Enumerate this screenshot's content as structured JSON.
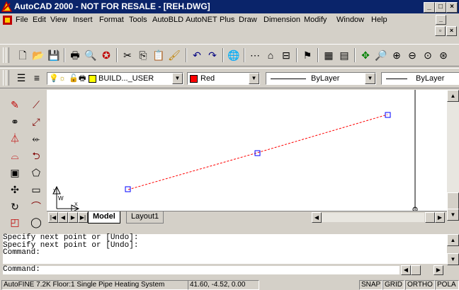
{
  "titlebar": {
    "title": "AutoCAD 2000 - NOT FOR RESALE - [REH.DWG]",
    "min": "_",
    "max": "□",
    "close": "×"
  },
  "menu": {
    "items": [
      "File",
      "Edit",
      "View",
      "Insert",
      "Format",
      "Tools",
      "AutoBLD",
      "AutoNET",
      "Plus",
      "Draw",
      "Dimension",
      "Modify",
      "Window",
      "Help"
    ]
  },
  "layers": {
    "layer_name": "BUILD..._USER",
    "color": "Red",
    "linetype": "ByLayer",
    "lineweight": "ByLayer"
  },
  "tabs": {
    "model": "Model",
    "layout": "Layout1"
  },
  "command": {
    "history": [
      "Specify next point or [Undo]:",
      "Specify next point or [Undo]:",
      "Command:"
    ],
    "prompt": "Command:"
  },
  "status": {
    "info": "AutoFINE 7.2K Floor:1 Single Pipe Heating System",
    "coords": "41.60, -4.52, 0.00",
    "snap": "SNAP",
    "grid": "GRID",
    "ortho": "ORTHO",
    "polar": "POLA"
  },
  "colors": {
    "accent": "#0a246a",
    "line": "#ff0000",
    "grips": "#0000ff",
    "swatch": "#ff0000"
  }
}
